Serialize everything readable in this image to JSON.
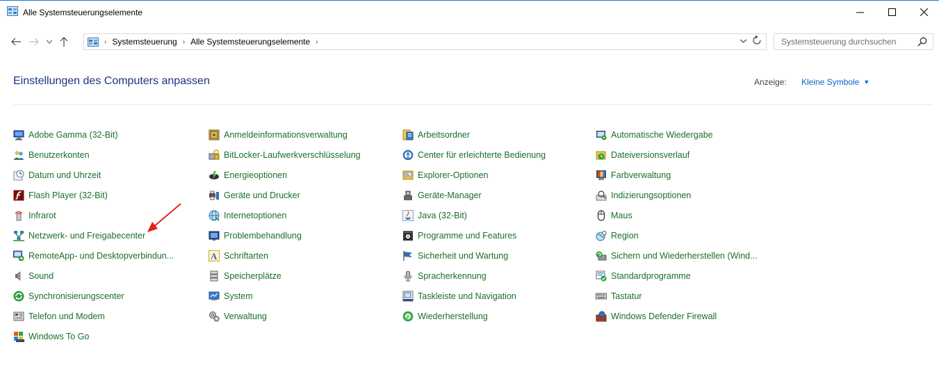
{
  "window": {
    "title": "Alle Systemsteuerungselemente",
    "controls": {
      "minimize": "—",
      "maximize": "☐",
      "close": "✕"
    }
  },
  "navbar": {
    "breadcrumbs": [
      "Systemsteuerung",
      "Alle Systemsteuerungselemente"
    ],
    "search_placeholder": "Systemsteuerung durchsuchen"
  },
  "header": {
    "title": "Einstellungen des Computers anpassen",
    "view_by_label": "Anzeige:",
    "view_by_value": "Kleine Symbole"
  },
  "columns": [
    [
      {
        "label": "Adobe Gamma (32-Bit)",
        "icon": "monitor-icon"
      },
      {
        "label": "Benutzerkonten",
        "icon": "users-icon"
      },
      {
        "label": "Datum und Uhrzeit",
        "icon": "clock-icon"
      },
      {
        "label": "Flash Player (32-Bit)",
        "icon": "flash-icon"
      },
      {
        "label": "Infrarot",
        "icon": "infrared-icon"
      },
      {
        "label": "Netzwerk- und Freigabecenter",
        "icon": "network-icon"
      },
      {
        "label": "RemoteApp- und Desktopverbindun...",
        "icon": "remote-icon"
      },
      {
        "label": "Sound",
        "icon": "speaker-icon"
      },
      {
        "label": "Synchronisierungscenter",
        "icon": "sync-icon"
      },
      {
        "label": "Telefon und Modem",
        "icon": "phone-icon"
      },
      {
        "label": "Windows To Go",
        "icon": "usb-icon"
      }
    ],
    [
      {
        "label": "Anmeldeinformationsverwaltung",
        "icon": "vault-icon"
      },
      {
        "label": "BitLocker-Laufwerkverschlüsselung",
        "icon": "bitlocker-icon"
      },
      {
        "label": "Energieoptionen",
        "icon": "power-icon"
      },
      {
        "label": "Geräte und Drucker",
        "icon": "printer-icon"
      },
      {
        "label": "Internetoptionen",
        "icon": "globe-icon"
      },
      {
        "label": "Problembehandlung",
        "icon": "troubleshoot-icon"
      },
      {
        "label": "Schriftarten",
        "icon": "font-icon"
      },
      {
        "label": "Speicherplätze",
        "icon": "storage-icon"
      },
      {
        "label": "System",
        "icon": "system-icon"
      },
      {
        "label": "Verwaltung",
        "icon": "admin-tools-icon"
      }
    ],
    [
      {
        "label": "Arbeitsordner",
        "icon": "work-folders-icon"
      },
      {
        "label": "Center für erleichterte Bedienung",
        "icon": "ease-of-access-icon"
      },
      {
        "label": "Explorer-Optionen",
        "icon": "explorer-options-icon"
      },
      {
        "label": "Geräte-Manager",
        "icon": "device-manager-icon"
      },
      {
        "label": "Java (32-Bit)",
        "icon": "java-icon"
      },
      {
        "label": "Programme und Features",
        "icon": "programs-icon"
      },
      {
        "label": "Sicherheit und Wartung",
        "icon": "flag-icon"
      },
      {
        "label": "Spracherkennung",
        "icon": "microphone-icon"
      },
      {
        "label": "Taskleiste und Navigation",
        "icon": "taskbar-icon"
      },
      {
        "label": "Wiederherstellung",
        "icon": "recovery-icon"
      }
    ],
    [
      {
        "label": "Automatische Wiedergabe",
        "icon": "autoplay-icon"
      },
      {
        "label": "Dateiversionsverlauf",
        "icon": "file-history-icon"
      },
      {
        "label": "Farbverwaltung",
        "icon": "color-management-icon"
      },
      {
        "label": "Indizierungsoptionen",
        "icon": "indexing-icon"
      },
      {
        "label": "Maus",
        "icon": "mouse-icon"
      },
      {
        "label": "Region",
        "icon": "region-icon"
      },
      {
        "label": "Sichern und Wiederherstellen (Wind...",
        "icon": "backup-icon"
      },
      {
        "label": "Standardprogramme",
        "icon": "default-programs-icon"
      },
      {
        "label": "Tastatur",
        "icon": "keyboard-icon"
      },
      {
        "label": "Windows Defender Firewall",
        "icon": "firewall-icon"
      }
    ]
  ],
  "colors": {
    "link": "#2a5f9e",
    "heading": "#1e3287",
    "accent": "#0066cc",
    "annotation_arrow": "#e02020"
  }
}
